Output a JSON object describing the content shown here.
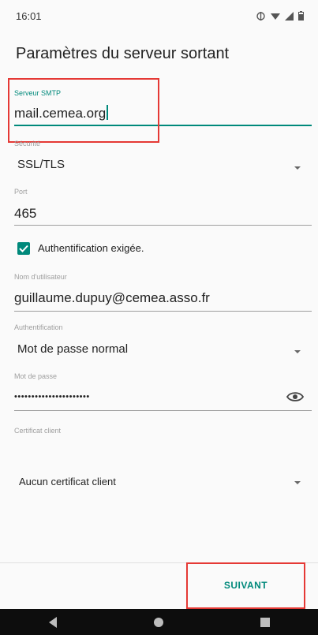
{
  "status_bar": {
    "time": "16:01"
  },
  "header": {
    "title": "Paramètres du serveur sortant"
  },
  "smtp_server": {
    "label": "Serveur SMTP",
    "value": "mail.cemea.org"
  },
  "security": {
    "label": "Sécurité",
    "value": "SSL/TLS"
  },
  "port": {
    "label": "Port",
    "value": "465"
  },
  "auth_required": {
    "label": "Authentification exigée.",
    "checked": true
  },
  "username": {
    "label": "Nom d'utilisateur",
    "value": "guillaume.dupuy@cemea.asso.fr"
  },
  "auth_method": {
    "label": "Authentification",
    "value": "Mot de passe normal"
  },
  "password": {
    "label": "Mot de passe",
    "value": "••••••••••••••••••••••"
  },
  "client_cert": {
    "label": "Certificat client",
    "value": "Aucun certificat client"
  },
  "footer": {
    "next_label": "SUIVANT"
  },
  "colors": {
    "accent": "#00897b",
    "highlight": "#e53935"
  }
}
